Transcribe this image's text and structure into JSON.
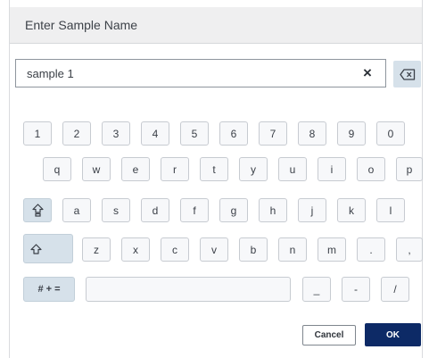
{
  "dialog": {
    "title": "Enter Sample Name",
    "input_value": "sample 1",
    "clear_symbol": "×",
    "cancel_label": "Cancel",
    "ok_label": "OK",
    "accent_color": "#0d2a66",
    "modifier_key_color": "#d6e1ea"
  },
  "keyboard": {
    "row1": [
      "1",
      "2",
      "3",
      "4",
      "5",
      "6",
      "7",
      "8",
      "9",
      "0"
    ],
    "row2": [
      "q",
      "w",
      "e",
      "r",
      "t",
      "y",
      "u",
      "i",
      "o",
      "p"
    ],
    "row3": [
      "a",
      "s",
      "d",
      "f",
      "g",
      "h",
      "j",
      "k",
      "l"
    ],
    "row4": [
      "z",
      "x",
      "c",
      "v",
      "b",
      "n",
      "m",
      ".",
      ","
    ],
    "row5": [
      "_",
      "-",
      "/"
    ],
    "symbols_label": "# + =",
    "icons": {
      "caps_lock": "caps-lock-icon",
      "shift": "shift-icon",
      "backspace": "backspace-icon"
    }
  }
}
